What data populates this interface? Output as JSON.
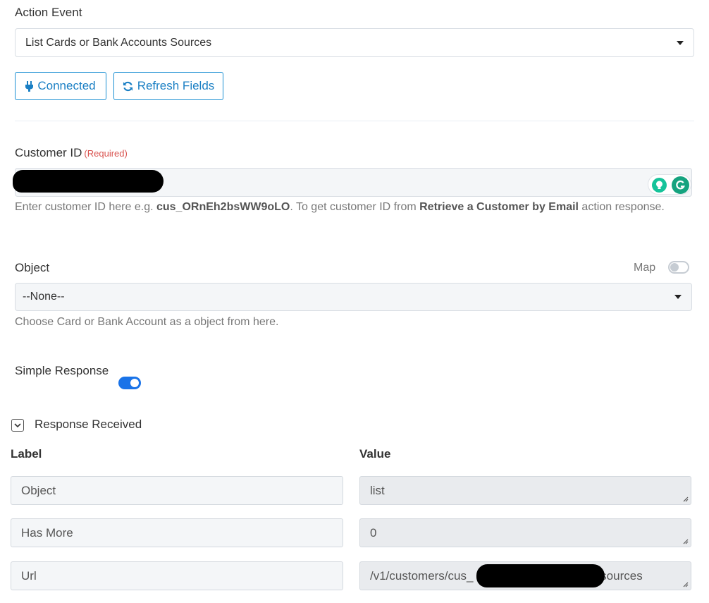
{
  "action_event": {
    "label": "Action Event",
    "selected": "List Cards or Bank Accounts Sources"
  },
  "buttons": {
    "connected": "Connected",
    "refresh": "Refresh Fields"
  },
  "customer_id": {
    "label": "Customer ID",
    "required": "(Required)",
    "help_prefix": "Enter customer ID here e.g. ",
    "help_example": "cus_ORnEh2bsWW9oLO",
    "help_mid": ". To get customer ID from ",
    "help_link": "Retrieve a Customer by Email",
    "help_suffix": " action response."
  },
  "object_field": {
    "label": "Object",
    "map_label": "Map",
    "selected": "--None--",
    "help": "Choose Card or Bank Account as a object from here."
  },
  "simple_response": {
    "label": "Simple Response",
    "enabled": true
  },
  "response": {
    "title": "Response Received",
    "col_label": "Label",
    "col_value": "Value",
    "rows": [
      {
        "label": "Object",
        "value": "list"
      },
      {
        "label": "Has More",
        "value": "0"
      },
      {
        "label": "Url",
        "value_prefix": "/v1/customers/cus_",
        "value_suffix": "/sources"
      }
    ]
  },
  "icons": {
    "plug": "plug-icon",
    "refresh": "refresh-icon",
    "bulb": "bulb-icon",
    "grammarly": "grammarly-icon"
  },
  "colors": {
    "accent": "#1a7fc4",
    "toggle_on": "#1a73e8",
    "required": "#d9534f",
    "grammarly": "#15c39a"
  }
}
